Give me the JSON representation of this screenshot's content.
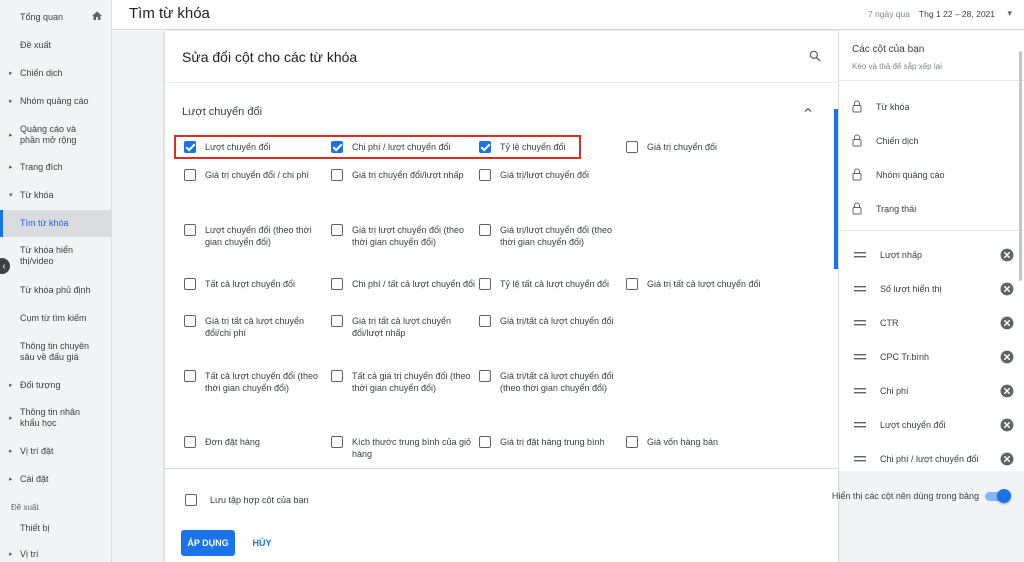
{
  "nav": {
    "items": [
      {
        "label": "Tổng quan",
        "caret": false
      },
      {
        "label": "Đề xuất",
        "caret": false
      },
      {
        "label": "Chiến dịch",
        "caret": true
      },
      {
        "label": "Nhóm quảng cáo",
        "caret": true
      },
      {
        "label": "Quảng cáo và phần mở rộng",
        "caret": true
      },
      {
        "label": "Trang đích",
        "caret": true
      },
      {
        "label": "Từ khóa",
        "caret": "down"
      },
      {
        "label": "Tìm từ khóa",
        "active": true
      },
      {
        "label": "Từ khóa hiển thị/video"
      },
      {
        "label": "Từ khóa phủ định"
      },
      {
        "label": "Cụm từ tìm kiếm"
      },
      {
        "label": "Thông tin chuyên sâu về đấu giá"
      },
      {
        "label": "Đối tượng",
        "caret": true
      },
      {
        "label": "Thông tin nhân khẩu học",
        "caret": true
      },
      {
        "label": "Vị trí đặt",
        "caret": true
      },
      {
        "label": "Cài đặt",
        "caret": true
      }
    ],
    "section_label": "Đề xuất",
    "extra_items": [
      {
        "label": "Thiết bị"
      },
      {
        "label": "Vị trí"
      }
    ]
  },
  "header": {
    "title": "Tìm từ khóa",
    "date_range_label": "7 ngày qua",
    "date_range": "Thg 1 22 – 28, 2021"
  },
  "dialog": {
    "title": "Sửa đổi cột cho các từ khóa",
    "section": "Lượt chuyển đổi",
    "options": [
      {
        "label": "Lượt chuyển đổi",
        "checked": true
      },
      {
        "label": "Chi phí / lượt chuyển đổi",
        "checked": true
      },
      {
        "label": "Tỷ lệ chuyển đổi",
        "checked": true
      },
      {
        "label": "Giá trị chuyển đổi",
        "checked": false
      },
      {
        "label": "Giá trị chuyển đổi / chi phí",
        "checked": false
      },
      {
        "label": "Giá trị chuyển đổi/lượt nhấp",
        "checked": false
      },
      {
        "label": "Giá trị/lượt chuyển đổi",
        "checked": false
      },
      {
        "label": "Lượt chuyển đổi (theo thời gian chuyển đổi)",
        "checked": false
      },
      {
        "label": "Giá trị lượt chuyển đổi (theo thời gian chuyển đổi)",
        "checked": false
      },
      {
        "label": "Giá trị/lượt chuyển đổi (theo thời gian chuyển đổi)",
        "checked": false
      },
      {
        "label": "Tất cả lượt chuyển đổi",
        "checked": false
      },
      {
        "label": "Chi phí / tất cả lượt chuyển đổi",
        "checked": false
      },
      {
        "label": "Tỷ lệ tất cả lượt chuyển đổi",
        "checked": false
      },
      {
        "label": "Giá trị tất cả lượt chuyển đổi",
        "checked": false
      },
      {
        "label": "Giá trị tất cả lượt chuyển đổi/chi phí",
        "checked": false
      },
      {
        "label": "Giá trị tất cả lượt chuyển đổi/lượt nhấp",
        "checked": false
      },
      {
        "label": "Giá trị/tất cả lượt chuyển đổi",
        "checked": false
      },
      {
        "label": "Tất cả lượt chuyển đổi (theo thời gian chuyển đổi)",
        "checked": false
      },
      {
        "label": "Tất cả giá trị chuyển đổi (theo thời gian chuyển đổi)",
        "checked": false
      },
      {
        "label": "Giá trị/tất cả lượt chuyển đổi (theo thời gian chuyển đổi)",
        "checked": false
      },
      {
        "label": "Đơn đặt hàng",
        "checked": false
      },
      {
        "label": "Kích thước trung bình của giỏ hàng",
        "checked": false
      },
      {
        "label": "Giá trị đặt hàng trung bình",
        "checked": false
      },
      {
        "label": "Giá vốn hàng bán",
        "checked": false
      }
    ],
    "save_label": "Lưu tập hợp cột của bạn",
    "recommend_label": "Hiển thị các cột nên dùng trong bảng",
    "recommend_on": true,
    "apply_label": "ÁP DỤNG",
    "cancel_label": "HỦY"
  },
  "your_columns": {
    "title": "Các cột của bạn",
    "subtitle": "Kéo và thả để sắp xếp lại",
    "locked": [
      "Từ khóa",
      "Chiến dịch",
      "Nhóm quảng cáo",
      "Trạng thái"
    ],
    "movable": [
      "Lượt nhấp",
      "Số lượt hiển thị",
      "CTR",
      "CPC Tr.bình",
      "Chi phí",
      "Lượt chuyển đổi",
      "Chi phí / lượt chuyển đổi"
    ]
  },
  "colors": {
    "accent": "#1a73e8",
    "highlight": "#d93025"
  }
}
